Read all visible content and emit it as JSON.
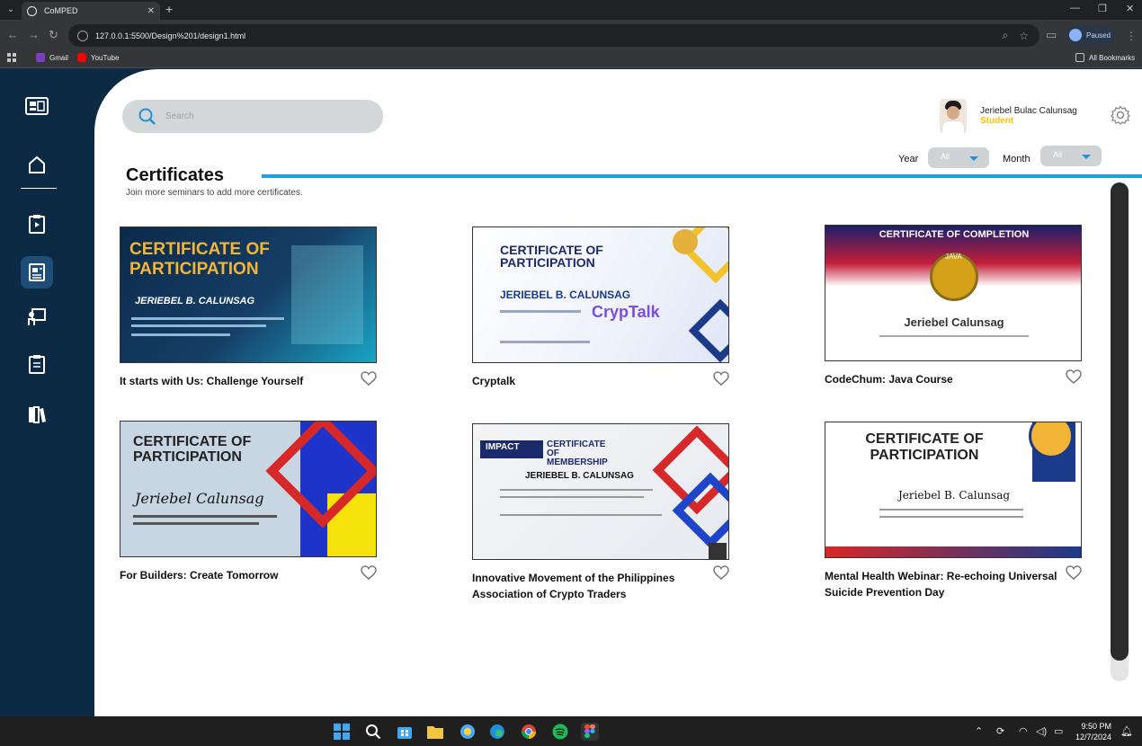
{
  "browser": {
    "tab_title": "CoMPED",
    "url": "127.0.0.1:5500/Design%201/design1.html",
    "profile_status": "Paused",
    "bookmarks": [
      {
        "label": "Gmail",
        "icon": "gmail-icon"
      },
      {
        "label": "YouTube",
        "icon": "youtube-icon"
      }
    ],
    "all_bookmarks": "All Bookmarks"
  },
  "search": {
    "placeholder": "Search"
  },
  "user": {
    "name": "Jeriebel Bulac Calunsag",
    "role": "Student"
  },
  "filters": {
    "year_label": "Year",
    "year_value": "All",
    "month_label": "Month",
    "month_value": "All"
  },
  "page": {
    "title": "Certificates",
    "subtitle": "Join more seminars to add more certificates."
  },
  "certificates": [
    {
      "title": "It starts with Us: Challenge Yourself",
      "preview": {
        "heading": "CERTIFICATE OF PARTICIPATION",
        "name": "JERIEBEL B. CALUNSAG"
      }
    },
    {
      "title": "Cryptalk",
      "preview": {
        "heading": "CERTIFICATE OF PARTICIPATION",
        "name": "JERIEBEL B. CALUNSAG",
        "brand": "CrypTalk"
      }
    },
    {
      "title": "CodeChum: Java Course",
      "preview": {
        "heading": "CERTIFICATE OF COMPLETION",
        "name": "Jeriebel Calunsag",
        "badge": "JAVA"
      }
    },
    {
      "title": "For Builders: Create Tomorrow",
      "preview": {
        "heading": "CERTIFICATE OF PARTICIPATION",
        "name": "Jeriebel Calunsag"
      }
    },
    {
      "title": "Innovative Movement of the Philippines Association of Crypto Traders",
      "preview": {
        "heading": "CERTIFICATE OF MEMBERSHIP",
        "name": "JERIEBEL B. CALUNSAG",
        "brand": "IMPACT"
      }
    },
    {
      "title": "Mental Health Webinar: Re-echoing Universal Suicide Prevention Day",
      "preview": {
        "heading": "CERTIFICATE OF PARTICIPATION",
        "name": "Jeriebel B. Calunsag"
      }
    }
  ],
  "taskbar": {
    "time": "9:50 PM",
    "date": "12/7/2024"
  },
  "colors": {
    "sidebar_bg": "#0d2a45",
    "accent_blue": "#1ea0e6",
    "role_yellow": "#f5c400",
    "active_nav": "#1e4d77"
  }
}
